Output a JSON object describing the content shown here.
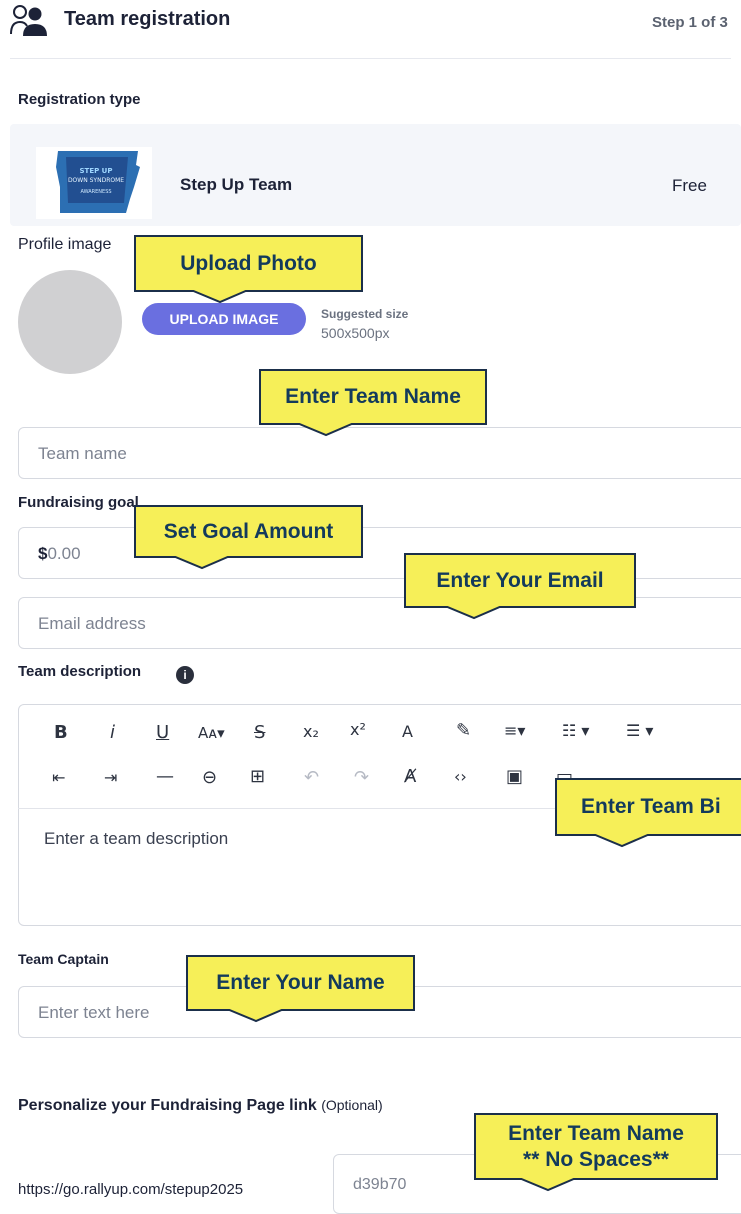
{
  "header": {
    "title": "Team registration",
    "step": "Step 1 of 3"
  },
  "registration": {
    "section_label": "Registration type",
    "option_name": "Step Up Team",
    "option_price": "Free",
    "logo_text": "STEP UP DOWN SYNDROME"
  },
  "profile": {
    "label": "Profile image",
    "upload_button": "UPLOAD IMAGE",
    "suggested_label": "Suggested size",
    "suggested_value": "500x500px"
  },
  "team_name": {
    "placeholder": "Team name"
  },
  "goal": {
    "label": "Fundraising goal",
    "currency": "$",
    "value": "0.00"
  },
  "email": {
    "placeholder": "Email address"
  },
  "description": {
    "label": "Team description",
    "placeholder": "Enter a team description",
    "toolbar_row1": [
      "B",
      "i",
      "U",
      "Aa▾",
      "S",
      "x₂",
      "x²",
      "A",
      "eraser",
      "align▾",
      "ol▾",
      "ul▾"
    ],
    "toolbar_row2": [
      "outdent",
      "indent",
      "hr",
      "link",
      "table",
      "undo",
      "redo",
      "clear-format",
      "code",
      "image",
      "video"
    ]
  },
  "captain": {
    "label": "Team Captain",
    "placeholder": "Enter text here"
  },
  "link": {
    "label": "Personalize your Fundraising Page link",
    "optional": "(Optional)",
    "prefix": "https://go.rallyup.com/stepup2025",
    "value": "d39b70"
  },
  "callouts": {
    "upload_photo": "Upload Photo",
    "team_name": "Enter Team Name",
    "goal": "Set Goal Amount",
    "email": "Enter Your Email",
    "team_bio": "Enter Team Bi",
    "your_name": "Enter Your Name",
    "slug_line1": "Enter Team Name",
    "slug_line2": "** No Spaces**"
  },
  "colors": {
    "accent": "#6a6fe0",
    "callout_fill": "#f6ef58",
    "callout_border": "#1b2f4a",
    "card_bg": "#f4f6fa"
  }
}
